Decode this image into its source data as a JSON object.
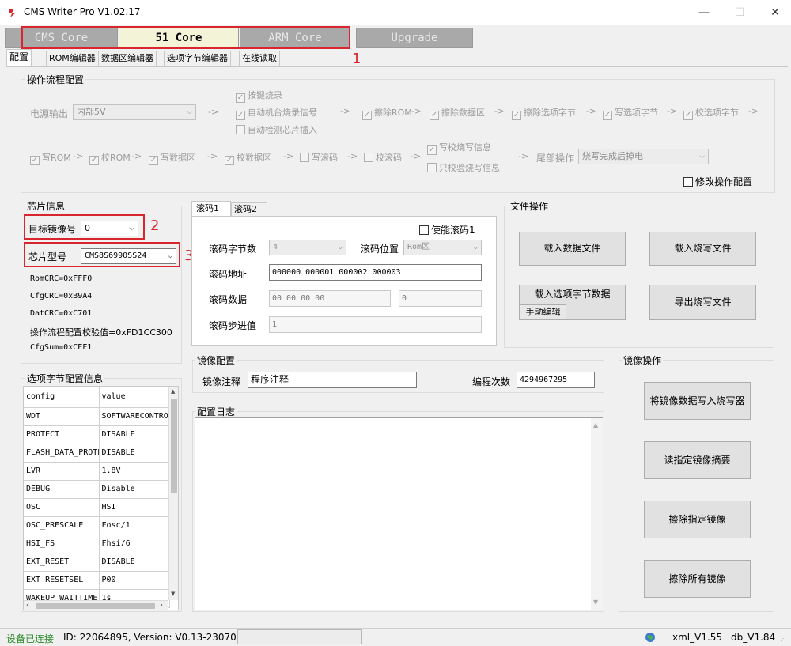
{
  "window": {
    "title": "CMS Writer Pro V1.02.17"
  },
  "core_tabs": {
    "cms": "CMS Core",
    "c51": "51 Core",
    "arm": "ARM Core",
    "upgrade": "Upgrade"
  },
  "annotations": {
    "n1": "1",
    "n2": "2",
    "n3": "3"
  },
  "sub_tabs": {
    "config": "配置",
    "rom": "ROM编辑器",
    "data": "数据区编辑器",
    "option": "选项字节编辑器",
    "online": "在线读取"
  },
  "flow": {
    "title": "操作流程配置",
    "power_label": "电源输出",
    "power_value": "内部5V",
    "key_burn": "按键烧录",
    "auto_signal": "自动机台烧录信号",
    "auto_detect": "自动检测芯片插入",
    "erase_rom": "擦除ROM",
    "erase_data": "擦除数据区",
    "erase_option": "擦除选项字节",
    "write_option": "写选项字节",
    "verify_option": "校选项字节",
    "write_rom": "写ROM",
    "verify_rom": "校ROM",
    "write_data": "写数据区",
    "verify_data": "校数据区",
    "write_roll": "写滚码",
    "verify_roll": "校滚码",
    "write_verify_info": "写校烧写信息",
    "verify_info_only": "只校验烧写信息",
    "tail_label": "尾部操作",
    "tail_value": "烧写完成后掉电",
    "modify": "修改操作配置",
    "arrow": "->"
  },
  "chip": {
    "title": "芯片信息",
    "mirror_label": "目标镜像号",
    "mirror_value": "0",
    "model_label": "芯片型号",
    "model_value": "CMS8S6990SS24",
    "romcrc": "RomCRC=0xFFF0",
    "cfgcrc": "CfgCRC=0xB9A4",
    "datcrc": "DatCRC=0xC701",
    "flowcrc": "操作流程配置校验值=0xFD1CC300",
    "cfgsum": "CfgSum=0xCEF1"
  },
  "rolling": {
    "tab1": "滚码1",
    "tab2": "滚码2",
    "enable": "使能滚码1",
    "bytes_label": "滚码字节数",
    "bytes_value": "4",
    "pos_label": "滚码位置",
    "pos_value": "Rom区",
    "addr_label": "滚码地址",
    "addr_value": "000000 000001 000002 000003",
    "data_label": "滚码数据",
    "data_value": "00 00 00 00",
    "data_value2": "0",
    "step_label": "滚码步进值",
    "step_value": "1"
  },
  "file_ops": {
    "title": "文件操作",
    "load_data": "载入数据文件",
    "load_burn": "载入烧写文件",
    "load_option": "载入选项字节数据",
    "manual_edit": "手动编辑",
    "export_burn": "导出烧写文件"
  },
  "option_table": {
    "title": "选项字节配置信息",
    "headers": [
      "config",
      "value"
    ],
    "rows": [
      [
        "WDT",
        "SOFTWARECONTRO"
      ],
      [
        "PROTECT",
        "DISABLE"
      ],
      [
        "FLASH_DATA_PROTE",
        "DISABLE"
      ],
      [
        "LVR",
        "1.8V"
      ],
      [
        "DEBUG",
        "Disable"
      ],
      [
        "OSC",
        "HSI"
      ],
      [
        "OSC_PRESCALE",
        "Fosc/1"
      ],
      [
        "HSI_FS",
        "Fhsi/6"
      ],
      [
        "EXT_RESET",
        "DISABLE"
      ],
      [
        "EXT_RESETSEL",
        "P00"
      ],
      [
        "WAKEUP_WAITTIME",
        "1s"
      ]
    ]
  },
  "mirror_cfg": {
    "title": "镜像配置",
    "note_label": "镜像注释",
    "note_value": "程序注释",
    "count_label": "编程次数",
    "count_value": "4294967295"
  },
  "log": {
    "title": "配置日志"
  },
  "mirror_ops": {
    "title": "镜像操作",
    "write": "将镜像数据写入烧写器",
    "read_summary": "读指定镜像摘要",
    "erase_one": "擦除指定镜像",
    "erase_all": "擦除所有镜像"
  },
  "status": {
    "connected": "设备已连接",
    "device": "ID: 22064895, Version: V0.13-230704",
    "xml": "xml_V1.55",
    "db": "db_V1.84"
  },
  "colors": {
    "connected": "#2e8b2e",
    "annotation": "#d9252d",
    "active_tab": "#f3f3d8"
  }
}
